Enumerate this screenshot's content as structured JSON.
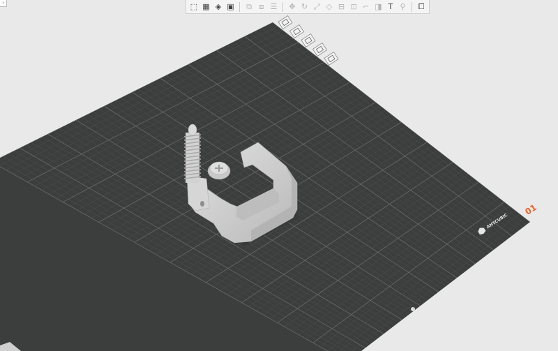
{
  "app": {
    "window_corner_glyph": "›"
  },
  "toolbar": {
    "groups": [
      [
        {
          "name": "add-object-icon",
          "glyph": "⬚",
          "enabled": true
        },
        {
          "name": "grid-icon",
          "glyph": "▦",
          "enabled": true
        },
        {
          "name": "auto-orient-icon",
          "glyph": "◈",
          "enabled": true
        },
        {
          "name": "arrange-icon",
          "glyph": "▣",
          "enabled": true
        }
      ],
      [
        {
          "name": "split-objects-icon",
          "glyph": "⧉",
          "enabled": false
        },
        {
          "name": "split-parts-icon",
          "glyph": "⧈",
          "enabled": false
        },
        {
          "name": "layers-icon",
          "glyph": "☰",
          "enabled": false
        }
      ],
      [
        {
          "name": "move-icon",
          "glyph": "✥",
          "enabled": false
        },
        {
          "name": "rotate-icon",
          "glyph": "↻",
          "enabled": false
        },
        {
          "name": "scale-icon",
          "glyph": "⤢",
          "enabled": false
        },
        {
          "name": "lay-on-face-icon",
          "glyph": "◇",
          "enabled": false
        },
        {
          "name": "cut-icon",
          "glyph": "⊟",
          "enabled": false
        },
        {
          "name": "supports-paint-icon",
          "glyph": "⊡",
          "enabled": false
        },
        {
          "name": "seam-paint-icon",
          "glyph": "⌐",
          "enabled": false
        },
        {
          "name": "color-paint-icon",
          "glyph": "◨",
          "enabled": false
        },
        {
          "name": "text-icon",
          "glyph": "T",
          "enabled": true
        },
        {
          "name": "measure-icon",
          "glyph": "⚲",
          "enabled": false
        }
      ],
      [
        {
          "name": "assembly-view-icon",
          "glyph": "⧠",
          "enabled": true
        }
      ]
    ]
  },
  "plate": {
    "brand": "ANYCUBIC",
    "plate_number": "01"
  },
  "colors": {
    "background": "#e9e9e9",
    "bed": "#3c3d3d",
    "grid_major": "#6a6a6a",
    "grid_minor": "#4f5050",
    "model": "#cdcdcd",
    "accent": "#e8652d"
  },
  "view_icons": [
    "view-iso-icon",
    "view-top-icon",
    "view-front-icon",
    "view-left-icon",
    "view-right-icon"
  ]
}
